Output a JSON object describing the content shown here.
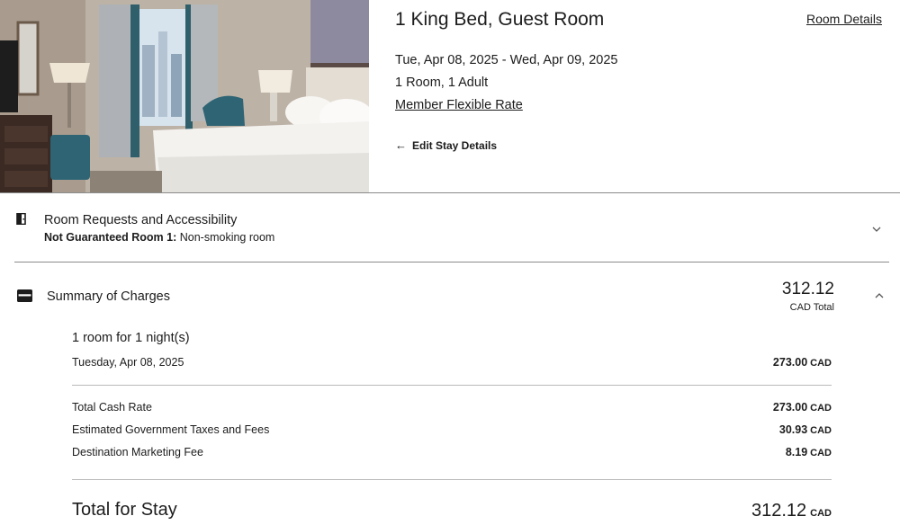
{
  "room": {
    "title": "1 King Bed, Guest Room",
    "details_link": "Room Details",
    "dates": "Tue, Apr 08, 2025 - Wed, Apr 09, 2025",
    "guests": "1 Room, 1 Adult",
    "rate_link": "Member Flexible Rate",
    "edit_stay": "Edit Stay Details"
  },
  "requests": {
    "title": "Room Requests and Accessibility",
    "sub_label": "Not Guaranteed Room 1:",
    "sub_value": "Non-smoking room"
  },
  "summary": {
    "title": "Summary of Charges",
    "total": "312.12",
    "total_sub": "CAD Total",
    "nights_label": "1 room for 1 night(s)",
    "night_rows": [
      {
        "label": "Tuesday, Apr 08, 2025",
        "amount": "273.00",
        "currency": "CAD"
      }
    ],
    "charge_rows": [
      {
        "label": "Total Cash Rate",
        "amount": "273.00",
        "currency": "CAD"
      },
      {
        "label": "Estimated Government Taxes and Fees",
        "amount": "30.93",
        "currency": "CAD"
      },
      {
        "label": "Destination Marketing Fee",
        "amount": "8.19",
        "currency": "CAD"
      }
    ],
    "grand_label": "Total for Stay",
    "grand_amount": "312.12",
    "grand_currency": "CAD"
  },
  "icons": {
    "arrow": "arrow-left-icon",
    "requests": "door-icon",
    "summary": "wallet-icon",
    "chevron_down": "chevron-down-icon",
    "chevron_up": "chevron-up-icon"
  }
}
